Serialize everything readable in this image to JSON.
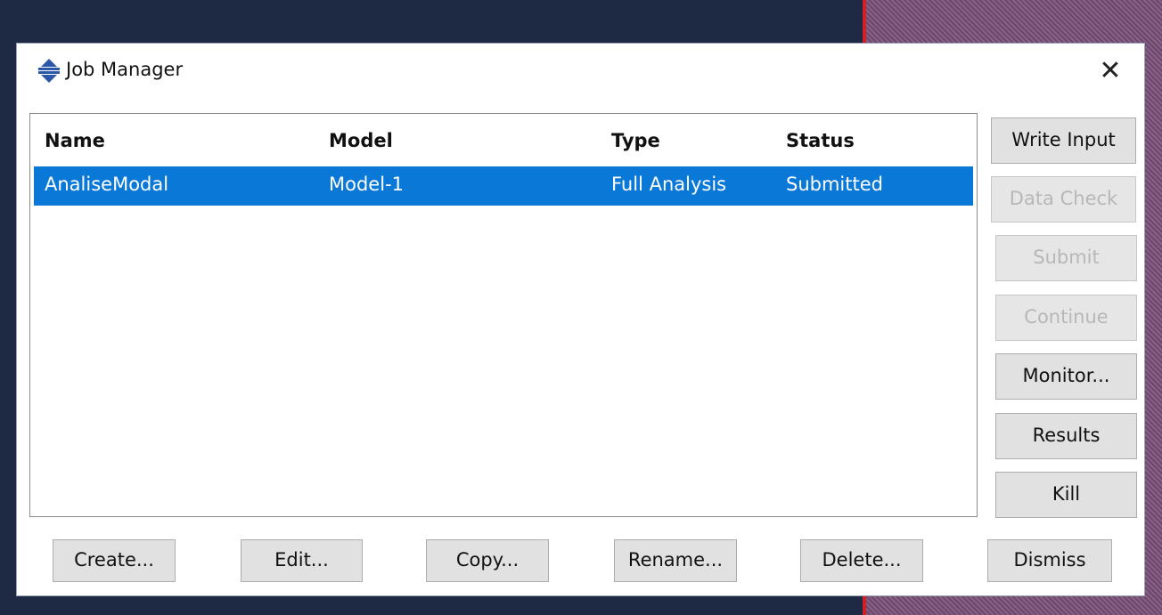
{
  "window": {
    "title": "Job Manager",
    "app_icon": "abaqus-icon",
    "close_glyph": "✕"
  },
  "table": {
    "columns": [
      "Name",
      "Model",
      "Type",
      "Status"
    ],
    "rows": [
      {
        "name": "AnaliseModal",
        "model": "Model-1",
        "type": "Full Analysis",
        "status": "Submitted",
        "selected": true
      }
    ]
  },
  "side_buttons": {
    "write_input": "Write Input",
    "data_check": "Data Check",
    "submit": "Submit",
    "continue": "Continue",
    "monitor": "Monitor...",
    "results": "Results",
    "kill": "Kill"
  },
  "bottom_buttons": {
    "create": "Create...",
    "edit": "Edit...",
    "copy": "Copy...",
    "rename": "Rename...",
    "delete": "Delete...",
    "dismiss": "Dismiss"
  },
  "colors": {
    "selection": "#0a78d7",
    "disabled_text": "#b7b7b7",
    "button_bg": "#e1e1e1"
  }
}
